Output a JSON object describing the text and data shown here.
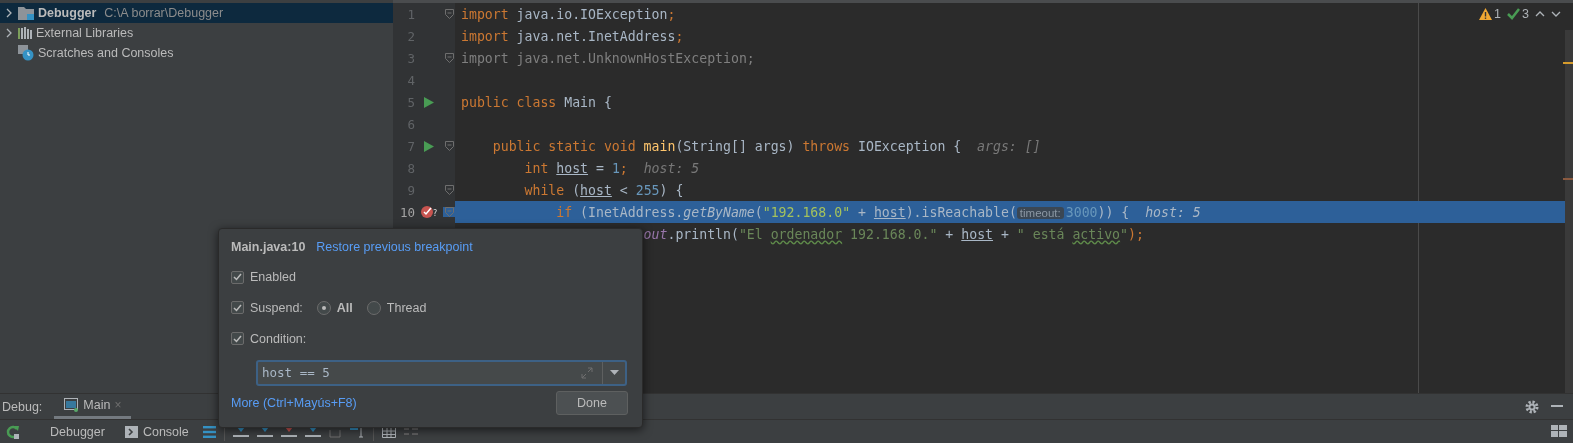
{
  "project_tree": {
    "items": [
      {
        "label": "Debugger",
        "path": "C:\\A borrar\\Debugger",
        "kind": "module",
        "selected": true,
        "expanded": false
      },
      {
        "label": "External Libraries",
        "kind": "libraries",
        "selected": false,
        "expanded": false
      },
      {
        "label": "Scratches and Consoles",
        "kind": "scratches",
        "selected": false
      }
    ]
  },
  "editor": {
    "problems": {
      "warnings": "1",
      "passed": "3"
    },
    "lines": [
      {
        "number": "1",
        "fold": true,
        "tokens": [
          {
            "kind": "kw",
            "s": "import"
          },
          {
            "kind": "plain",
            "s": " java.io.IOException"
          },
          {
            "kind": "kw",
            "s": ";"
          }
        ]
      },
      {
        "number": "2",
        "tokens": [
          {
            "kind": "kw",
            "s": "import"
          },
          {
            "kind": "plain",
            "s": " java.net.InetAddress"
          },
          {
            "kind": "kw",
            "s": ";"
          }
        ]
      },
      {
        "number": "3",
        "fold": true,
        "tokens": [
          {
            "kind": "gray",
            "s": "import java.net.UnknownHostException;"
          }
        ]
      },
      {
        "number": "4"
      },
      {
        "number": "5",
        "run": true,
        "tokens": [
          {
            "kind": "kw",
            "s": "public class "
          },
          {
            "kind": "plain",
            "s": "Main {"
          }
        ],
        "children": [
          {
            "number": "6"
          },
          {
            "number": "7",
            "run": true,
            "fold": true,
            "tokens": [
              {
                "kind": "kw",
                "s": "public static void "
              },
              {
                "kind": "fn",
                "s": "main"
              },
              {
                "kind": "plain",
                "s": "(String[] args) "
              },
              {
                "kind": "kw",
                "s": "throws "
              },
              {
                "kind": "plain",
                "s": "IOException {"
              }
            ],
            "hint": "args: []",
            "children": [
              {
                "number": "8",
                "tokens": [
                  {
                    "kind": "kw",
                    "s": "int "
                  },
                  {
                    "kind": "var",
                    "s": "host"
                  },
                  {
                    "kind": "plain",
                    "s": " = "
                  },
                  {
                    "kind": "num",
                    "s": "1"
                  },
                  {
                    "kind": "kw",
                    "s": ";"
                  }
                ],
                "hint": "host: 5"
              },
              {
                "number": "9",
                "fold": true,
                "tokens": [
                  {
                    "kind": "kw",
                    "s": "while "
                  },
                  {
                    "kind": "plain",
                    "s": "("
                  },
                  {
                    "kind": "var",
                    "s": "host"
                  },
                  {
                    "kind": "plain",
                    "s": " < "
                  },
                  {
                    "kind": "num",
                    "s": "255"
                  },
                  {
                    "kind": "plain",
                    "s": ") {"
                  }
                ],
                "children": [
                  {
                    "number": "10",
                    "fold": true,
                    "breakpoint": true,
                    "breakpoint_badge": "?",
                    "current": true,
                    "tokens": [
                      {
                        "kind": "kw",
                        "s": "if "
                      },
                      {
                        "kind": "plain",
                        "s": "(InetAddress."
                      },
                      {
                        "kind": "call",
                        "s": "getByName"
                      },
                      {
                        "kind": "plain",
                        "s": "("
                      },
                      {
                        "kind": "str",
                        "s": "\"192.168.0\""
                      },
                      {
                        "kind": "plain",
                        "s": " + "
                      },
                      {
                        "kind": "var",
                        "s": "host"
                      },
                      {
                        "kind": "plain",
                        "s": ").isReachable("
                      },
                      {
                        "kind": "inlay",
                        "s": "timeout:"
                      },
                      {
                        "kind": "num",
                        "s": "3000"
                      },
                      {
                        "kind": "plain",
                        "s": ")) {"
                      }
                    ],
                    "hint": "host: 5",
                    "children": [
                      {
                        "obscured": true,
                        "tokens": [
                          {
                            "kind": "static",
                            "s": "out"
                          },
                          {
                            "kind": "plain",
                            "s": ".println("
                          },
                          {
                            "kind": "str",
                            "s": "\"El "
                          },
                          {
                            "kind": "typo",
                            "s": "ordenador"
                          },
                          {
                            "kind": "str",
                            "s": " 192.168.0.\""
                          },
                          {
                            "kind": "plain",
                            "s": " + "
                          },
                          {
                            "kind": "var",
                            "s": "host"
                          },
                          {
                            "kind": "plain",
                            "s": " + "
                          },
                          {
                            "kind": "str",
                            "s": "\" está "
                          },
                          {
                            "kind": "typo",
                            "s": "activo"
                          },
                          {
                            "kind": "str",
                            "s": "\""
                          },
                          {
                            "kind": "kw",
                            "s": ");"
                          }
                        ]
                      }
                    ]
                  }
                ]
              }
            ]
          }
        ]
      }
    ]
  },
  "breakpoint_popup": {
    "location": "Main.java:10",
    "restore_link": "Restore previous breakpoint",
    "enabled": {
      "label": "Enabled",
      "checked": true
    },
    "suspend": {
      "label": "Suspend:",
      "checked": true,
      "options": [
        {
          "label": "All",
          "selected": true
        },
        {
          "label": "Thread",
          "selected": false
        }
      ]
    },
    "condition": {
      "label": "Condition:",
      "checked": true,
      "value": "host == 5"
    },
    "more_link": "More (Ctrl+Mayús+F8)",
    "done": "Done"
  },
  "debug_panel": {
    "label": "Debug:",
    "tabs": [
      {
        "label": "Main",
        "close": "×",
        "selected": true
      }
    ],
    "views": [
      {
        "label": "Debugger",
        "kind": "debugger"
      },
      {
        "label": "Console",
        "kind": "console"
      }
    ]
  }
}
